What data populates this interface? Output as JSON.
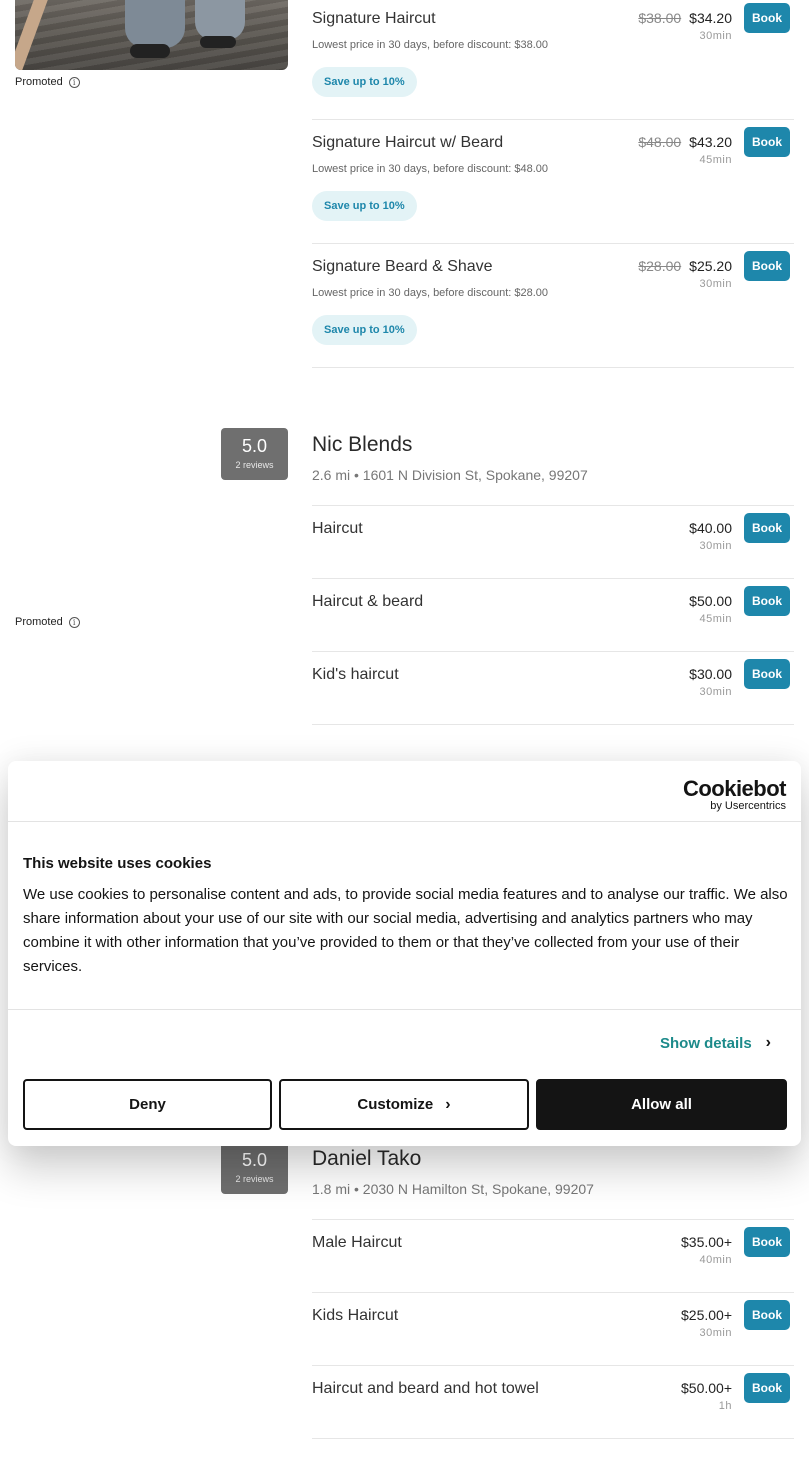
{
  "listing1": {
    "promoted_label": "Promoted",
    "services": [
      {
        "name": "Signature Haircut",
        "old_price": "$38.00",
        "price": "$34.20",
        "duration": "30min",
        "lowest": "Lowest price in 30 days, before discount: $38.00",
        "save": "Save up to 10%",
        "book": "Book"
      },
      {
        "name": "Signature Haircut w/ Beard",
        "old_price": "$48.00",
        "price": "$43.20",
        "duration": "45min",
        "lowest": "Lowest price in 30 days, before discount: $48.00",
        "save": "Save up to 10%",
        "book": "Book"
      },
      {
        "name": "Signature Beard & Shave",
        "old_price": "$28.00",
        "price": "$25.20",
        "duration": "30min",
        "lowest": "Lowest price in 30 days, before discount: $28.00",
        "save": "Save up to 10%",
        "book": "Book"
      }
    ]
  },
  "listing2": {
    "name": "Nic Blends",
    "address": "2.6 mi • 1601 N Division St, Spokane, 99207",
    "rating": "5.0",
    "reviews": "2 reviews",
    "promoted_label": "Promoted",
    "services": [
      {
        "name": "Haircut",
        "price": "$40.00",
        "duration": "30min",
        "book": "Book"
      },
      {
        "name": "Haircut & beard",
        "price": "$50.00",
        "duration": "45min",
        "book": "Book"
      },
      {
        "name": "Kid's haircut",
        "price": "$30.00",
        "duration": "30min",
        "book": "Book"
      }
    ]
  },
  "listing3": {
    "name": "Daniel Tako",
    "address": "1.8 mi • 2030 N Hamilton St, Spokane, 99207",
    "rating": "5.0",
    "reviews": "2 reviews",
    "services": [
      {
        "name": "Male Haircut",
        "price": "$35.00+",
        "duration": "40min",
        "book": "Book"
      },
      {
        "name": "Kids Haircut",
        "price": "$25.00+",
        "duration": "30min",
        "book": "Book"
      },
      {
        "name": "Haircut and beard and hot towel",
        "price": "$50.00+",
        "duration": "1h",
        "book": "Book"
      }
    ]
  },
  "cookie": {
    "brand": "Cookiebot",
    "brand_sub": "by Usercentrics",
    "title": "This website uses cookies",
    "text": "We use cookies to personalise content and ads, to provide social media features and to analyse our traffic. We also share information about your use of our site with our social media, advertising and analytics partners who may combine it with other information that you’ve provided to them or that they’ve collected from your use of their services.",
    "show_details": "Show details",
    "deny": "Deny",
    "customize": "Customize",
    "allow_all": "Allow all"
  },
  "colors": {
    "book_button": "#1e87ab",
    "save_pill_bg": "#e3f3f6",
    "rating_bg": "#6f6f6f",
    "cookie_link": "#1c8a8a",
    "allow_bg": "#141414"
  },
  "icons": {
    "info": "info-icon",
    "chevron": "chevron-right-icon"
  }
}
